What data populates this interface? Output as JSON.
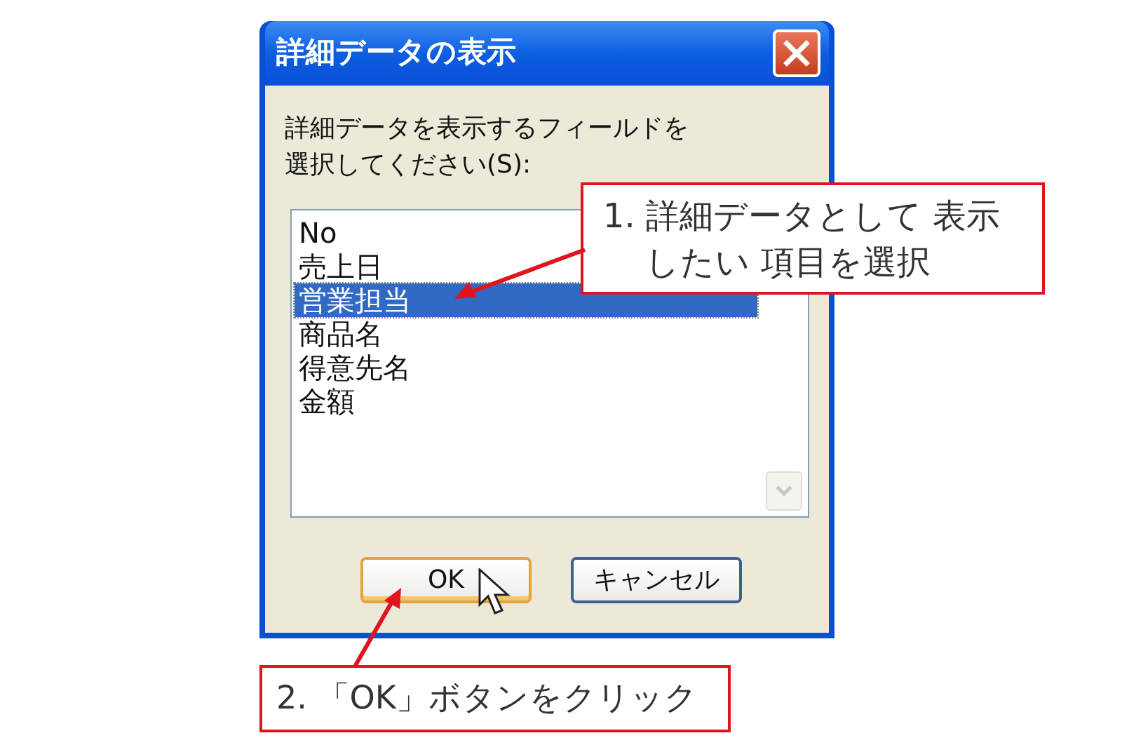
{
  "window": {
    "title": "詳細データの表示"
  },
  "prompt": [
    "詳細データを表示するフィールドを",
    "選択してください(S):"
  ],
  "list": {
    "items": [
      {
        "label": "No",
        "selected": false
      },
      {
        "label": "売上日",
        "selected": false
      },
      {
        "label": "営業担当",
        "selected": true
      },
      {
        "label": "商品名",
        "selected": false
      },
      {
        "label": "得意先名",
        "selected": false
      },
      {
        "label": "金額",
        "selected": false
      }
    ]
  },
  "buttons": [
    {
      "label": "OK",
      "focused": true
    },
    {
      "label": "キャンセル",
      "focused": false
    }
  ],
  "callouts": [
    {
      "lines": [
        "1. 詳細データとして 表示",
        "したい 項目を選択"
      ]
    },
    {
      "lines": [
        "2. 「OK」ボタンをクリック"
      ]
    }
  ]
}
